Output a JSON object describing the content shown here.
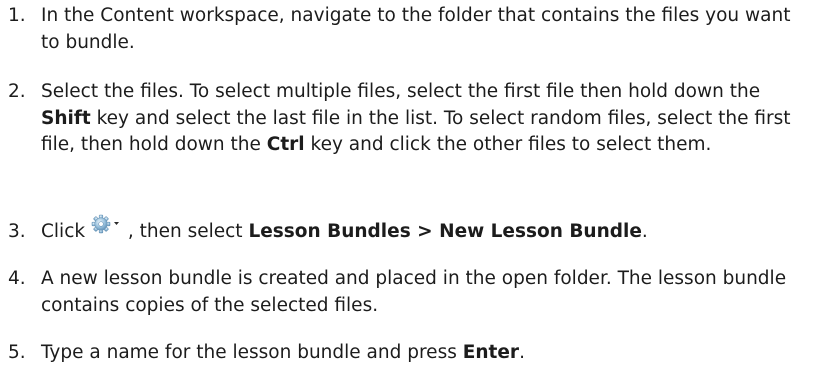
{
  "steps": [
    {
      "number": "1.",
      "parts": [
        {
          "t": "In the Content workspace, navigate to the folder that contains the files you want to bundle."
        }
      ]
    },
    {
      "number": "2.",
      "parts": [
        {
          "t": "Select the files. To select multiple files, select the first file then hold down the "
        },
        {
          "t": "Shift",
          "b": true
        },
        {
          "t": " key and select the last file in the list. To select random files, select the first file, then hold down the "
        },
        {
          "t": "Ctrl",
          "b": true
        },
        {
          "t": " key and click the other files to select them."
        }
      ]
    },
    {
      "number": "3.",
      "parts": [
        {
          "t": "Click "
        },
        {
          "icon": "gear-dropdown-icon"
        },
        {
          "t": " , then select "
        },
        {
          "t": "Lesson Bundles > New Lesson Bundle",
          "b": true
        },
        {
          "t": "."
        }
      ]
    },
    {
      "number": "4.",
      "parts": [
        {
          "t": "A new lesson bundle is created and placed in the open folder. The lesson bundle contains copies of the selected files."
        }
      ]
    },
    {
      "number": "5.",
      "parts": [
        {
          "t": "Type a name for the lesson bundle and press "
        },
        {
          "t": "Enter",
          "b": true
        },
        {
          "t": "."
        }
      ]
    }
  ]
}
